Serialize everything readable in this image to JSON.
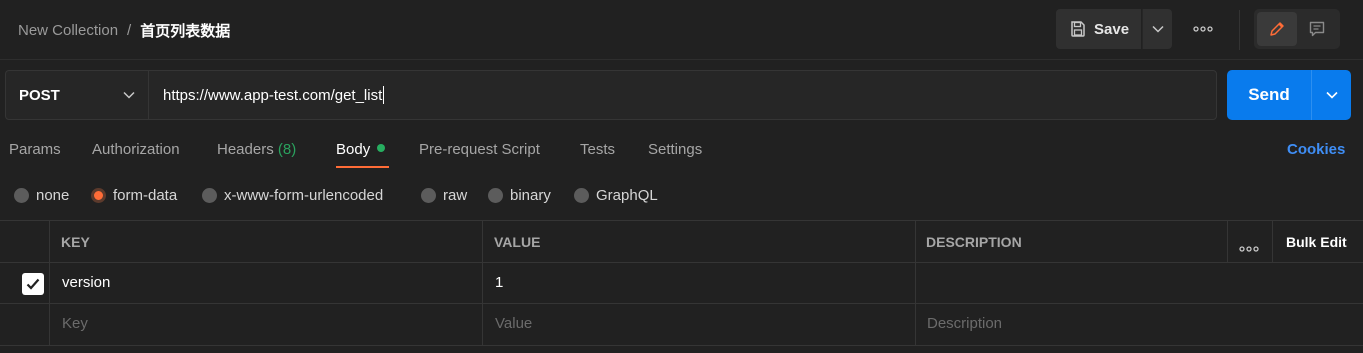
{
  "breadcrumb": {
    "collection": "New Collection",
    "separator": "/",
    "request": "首页列表数据"
  },
  "toolbar": {
    "save_label": "Save"
  },
  "request": {
    "method": "POST",
    "url": "https://www.app-test.com/get_list",
    "send_label": "Send"
  },
  "tabs": [
    {
      "label": "Params"
    },
    {
      "label": "Authorization"
    },
    {
      "label": "Headers",
      "count": "(8)"
    },
    {
      "label": "Body",
      "active": true
    },
    {
      "label": "Pre-request Script"
    },
    {
      "label": "Tests"
    },
    {
      "label": "Settings"
    }
  ],
  "cookies_label": "Cookies",
  "body_types": [
    {
      "label": "none"
    },
    {
      "label": "form-data",
      "selected": true
    },
    {
      "label": "x-www-form-urlencoded"
    },
    {
      "label": "raw"
    },
    {
      "label": "binary"
    },
    {
      "label": "GraphQL"
    }
  ],
  "table": {
    "headers": {
      "key": "KEY",
      "value": "VALUE",
      "description": "DESCRIPTION",
      "bulk_edit": "Bulk Edit"
    },
    "rows": [
      {
        "checked": true,
        "key": "version",
        "value": "1",
        "description": ""
      }
    ],
    "placeholders": {
      "key": "Key",
      "value": "Value",
      "description": "Description"
    }
  },
  "colors": {
    "accent": "#ff6c37",
    "send": "#097bed",
    "link": "#3f8ef5",
    "success": "#27ae60"
  },
  "icons": [
    "save-icon",
    "chevron-down-icon",
    "more-icon",
    "edit-icon",
    "comment-icon",
    "check-icon"
  ]
}
